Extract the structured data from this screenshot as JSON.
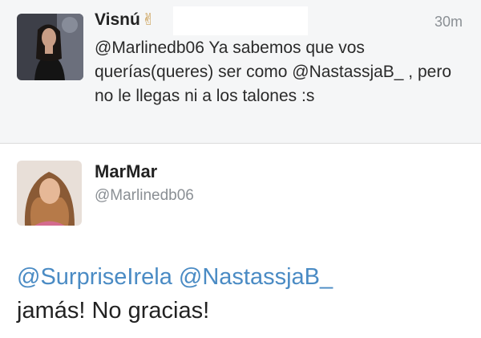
{
  "reply": {
    "author_name": "Visnú",
    "time": "30m",
    "text_mention": "@Marlinedb06",
    "text_body": " Ya sabemos que vos querías(queres) ser como @NastassjaB_ , pero no le llegas ni a los talones :s",
    "avatar_icon": "avatar-woman-dark-hair"
  },
  "main": {
    "author_name": "MarMar",
    "handle": "@Marlinedb06",
    "mention_1": "@SurpriseIrela",
    "mention_2": "@NastassjaB_",
    "body": "jamás! No gracias!",
    "avatar_icon": "avatar-woman-brown-hair"
  },
  "colors": {
    "link": "#4a8bc4",
    "muted": "#8a8f94",
    "reply_bg": "#f5f6f7"
  }
}
